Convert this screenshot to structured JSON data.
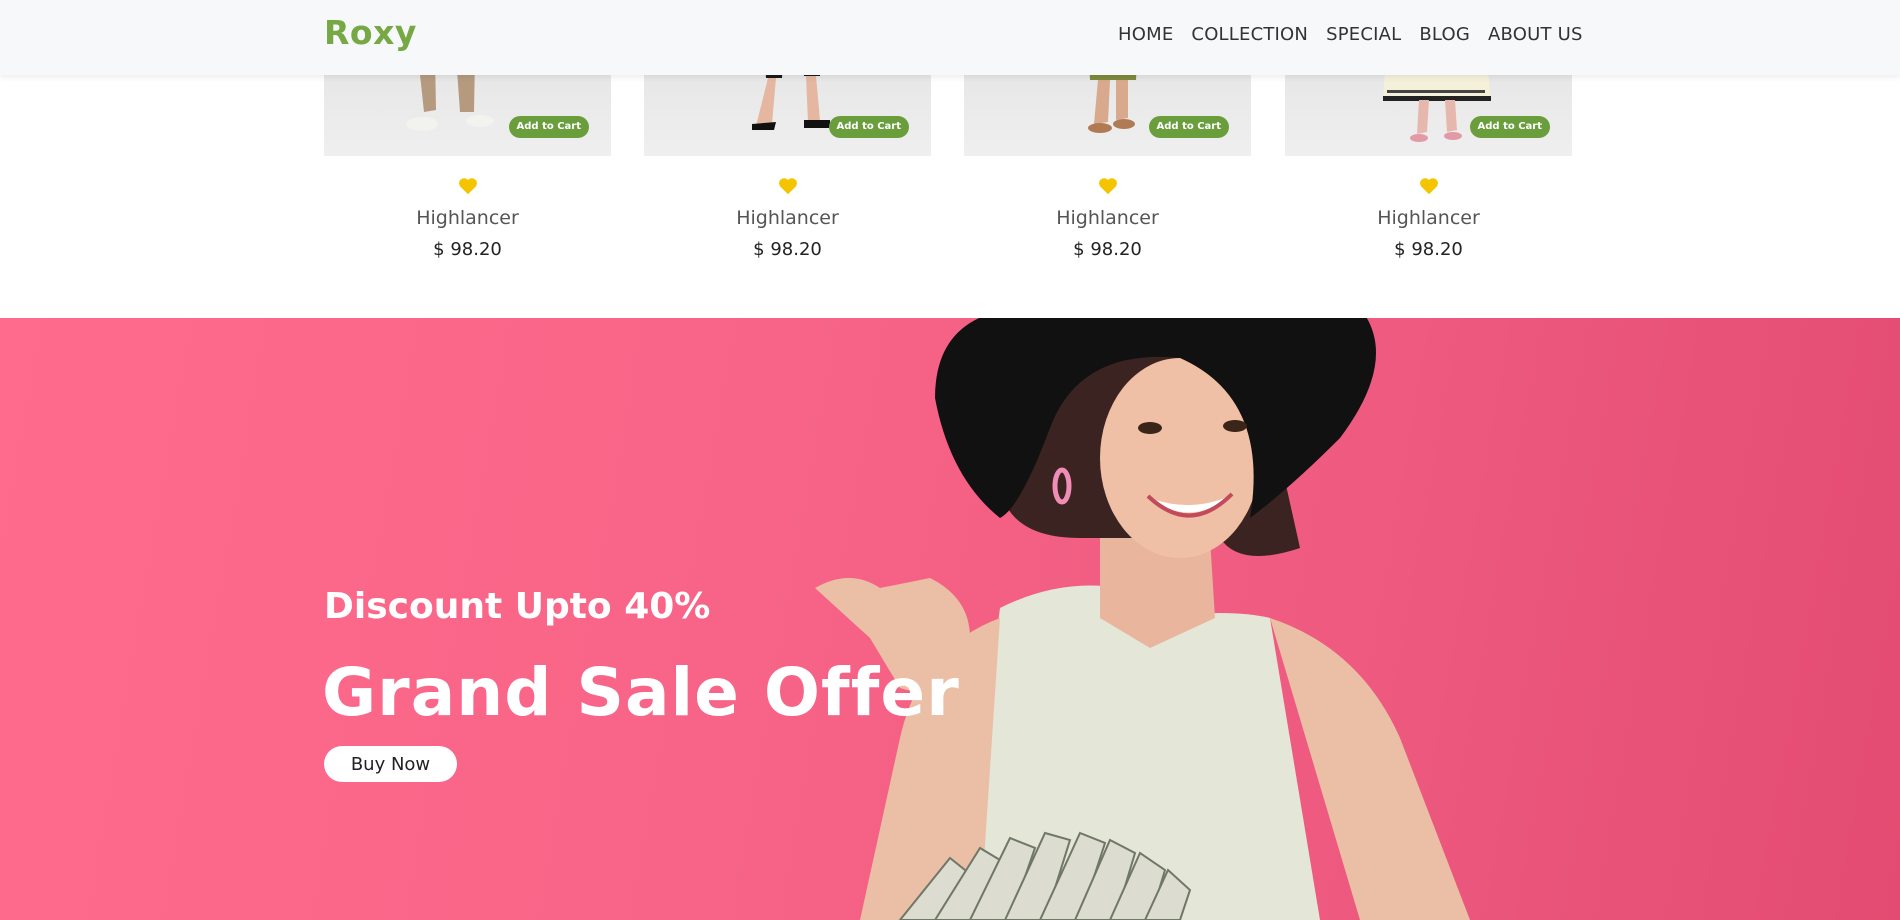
{
  "header": {
    "brand": "Roxy",
    "nav": [
      "HOME",
      "COLLECTION",
      "SPECIAL",
      "BLOG",
      "ABOUT US"
    ]
  },
  "products": [
    {
      "add_label": "Add to Cart",
      "name": "Highlancer",
      "price": "$ 98.20"
    },
    {
      "add_label": "Add to Cart",
      "name": "Highlancer",
      "price": "$ 98.20"
    },
    {
      "add_label": "Add to Cart",
      "name": "Highlancer",
      "price": "$ 98.20"
    },
    {
      "add_label": "Add to Cart",
      "name": "Highlancer",
      "price": "$ 98.20"
    }
  ],
  "banner": {
    "subtitle": "Discount Upto 40%",
    "title": "Grand Sale Offer",
    "button": "Buy Now"
  },
  "colors": {
    "brand": "#76a844",
    "add_button": "#6a9e3c",
    "heart": "#f5c400",
    "banner_bg": "#f76487"
  }
}
